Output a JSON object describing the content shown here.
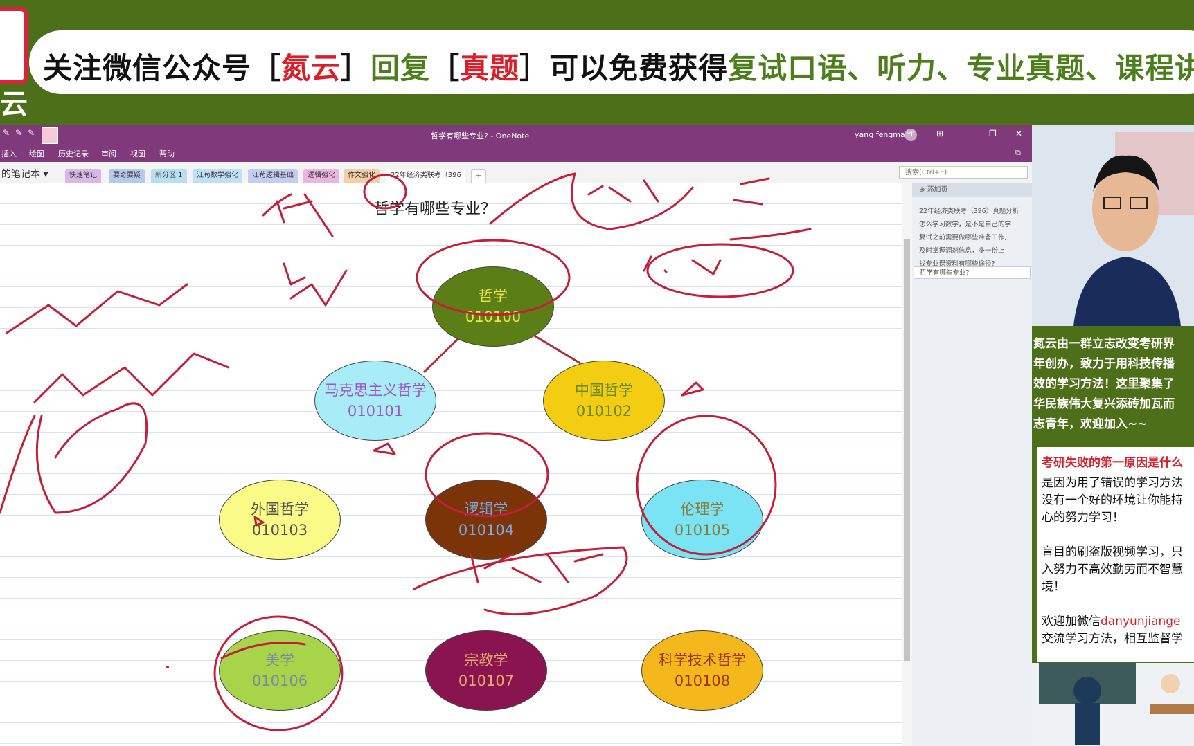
{
  "banner": {
    "segments": [
      {
        "text": "关注微信公众号［",
        "color": "black"
      },
      {
        "text": "氮云",
        "color": "red"
      },
      {
        "text": "］",
        "color": "black"
      },
      {
        "text": "回复",
        "color": "green"
      },
      {
        "text": "［",
        "color": "black"
      },
      {
        "text": "真题",
        "color": "red"
      },
      {
        "text": "］可以免费获得",
        "color": "black"
      },
      {
        "text": "复试口语、听力、专业真题、课程讲",
        "color": "green"
      }
    ],
    "logo_glyph": "云"
  },
  "window": {
    "title": "哲学有哪些专业?  -  OneNote",
    "user": "yang fengmai",
    "avatar": "YF",
    "ribbon": [
      "插入",
      "绘图",
      "历史记录",
      "审阅",
      "视图",
      "帮助"
    ],
    "notebook": "的笔记本",
    "tabs": [
      {
        "label": "快速笔记",
        "color": "#d9b7e8"
      },
      {
        "label": "要奇要疑",
        "color": "#b7c9ec"
      },
      {
        "label": "新分区 1",
        "color": "#b8dff0"
      },
      {
        "label": "江苟数学强化",
        "color": "#bfe0f6"
      },
      {
        "label": "江苟逻辑基础",
        "color": "#c5cdf2"
      },
      {
        "label": "逻辑强化",
        "color": "#e8b7e0"
      },
      {
        "label": "作文强化",
        "color": "#f3d0a8"
      },
      {
        "label": "22年经济类联考（396",
        "color": "#c7d7f2"
      }
    ],
    "add_tab": "+",
    "search_placeholder": "搜索(Ctrl+E)"
  },
  "pages_panel": {
    "add_page": "添加页",
    "items": [
      "22年经济类联考（396）真题分析",
      "怎么学习数学，是不是自己的学",
      "复试之前需要做哪些准备工作,",
      "及时掌握调剂信息，多一份上",
      "找专业课资料有哪些途径?"
    ],
    "selected": "哲学有哪些专业?"
  },
  "page": {
    "title": "哲学有哪些专业？",
    "nodes": [
      {
        "name": "哲学",
        "code": "010100",
        "fill": "#5b7f16",
        "text": "#e8e84a"
      },
      {
        "name": "马克思主义哲学",
        "code": "010101",
        "fill": "#a8ecf8",
        "text": "#a054c4"
      },
      {
        "name": "中国哲学",
        "code": "010102",
        "fill": "#f2cd12",
        "text": "#6a8a22"
      },
      {
        "name": "外国哲学",
        "code": "010103",
        "fill": "#fafa86",
        "text": "#555555"
      },
      {
        "name": "逻辑学",
        "code": "010104",
        "fill": "#7a3408",
        "text": "#7aa8e8"
      },
      {
        "name": "伦理学",
        "code": "010105",
        "fill": "#7ae4f4",
        "text": "#8a7a3a"
      },
      {
        "name": "美学",
        "code": "010106",
        "fill": "#a8d44a",
        "text": "#7a8aa0"
      },
      {
        "name": "宗教学",
        "code": "010107",
        "fill": "#8a1450",
        "text": "#e8a870"
      },
      {
        "name": "科学技术哲学",
        "code": "010108",
        "fill": "#f4b81c",
        "text": "#9a3a1a"
      }
    ]
  },
  "side": {
    "promo_intro": "氮云由一群立志改变考研界\n年创办，致力于用科技传播\n效的学习方法！这里聚集了\n华民族伟大复兴添砖加瓦而\n志青年，欢迎加入~~",
    "card_head": "考研失败的第一原因是什么",
    "card_body_1": "是因为用了错误的学习方法\n没有一个好的环境让你能持\n心的努力学习！\n\n盲目的刷盗版视频学习，只\n入努力不高效勤劳而不智慧\n境！\n\n欢迎加微信",
    "wechat": "danyunjiange",
    "card_body_2": "交流学习方法，相互监督学"
  }
}
